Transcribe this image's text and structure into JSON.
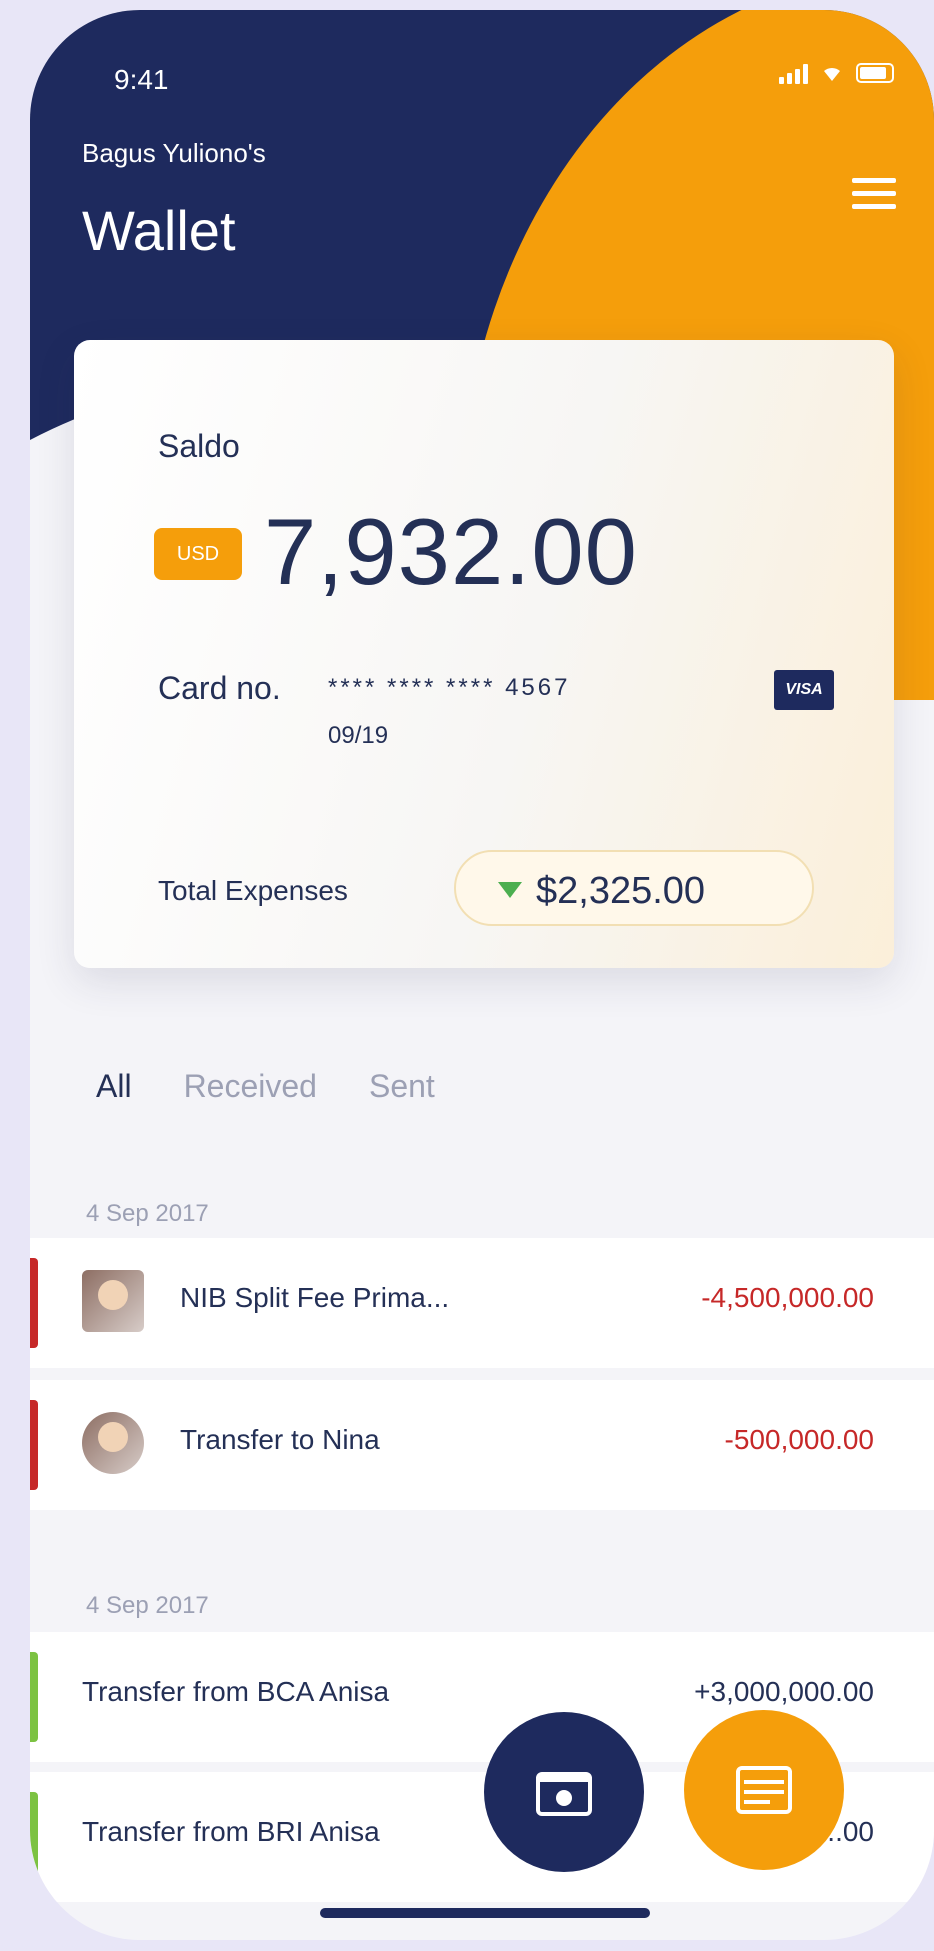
{
  "status": {
    "time": "9:41"
  },
  "header": {
    "owner": "Bagus Yuliono's",
    "title": "Wallet"
  },
  "card": {
    "saldo_label": "Saldo",
    "currency": "USD",
    "amount": "7,932.00",
    "card_no_label": "Card no.",
    "card_no": "****  ****  ****  4567",
    "expiry": "09/19",
    "brand": "VISA",
    "total_expenses_label": "Total Expenses",
    "total_expenses": "$2,325.00"
  },
  "tabs": [
    {
      "label": "All"
    },
    {
      "label": "Received"
    },
    {
      "label": "Sent"
    }
  ],
  "groups": [
    {
      "date": "4 Sep 2017",
      "items": [
        {
          "name": "NIB Split Fee Prima...",
          "value": "-4,500,000.00",
          "type": "out"
        },
        {
          "name": "Transfer to Nina",
          "value": "-500,000.00",
          "type": "out"
        }
      ]
    },
    {
      "date": "4 Sep 2017",
      "items": [
        {
          "name": "Transfer from BCA Anisa",
          "value": "+3,000,000.00",
          "type": "in"
        },
        {
          "name": "Transfer from BRI Anisa",
          "value": "+...00",
          "type": "in"
        }
      ]
    }
  ],
  "colors": {
    "navy": "#1e2a5e",
    "orange": "#f59e0b",
    "expense": "#c62828",
    "income": "#7cc242"
  }
}
